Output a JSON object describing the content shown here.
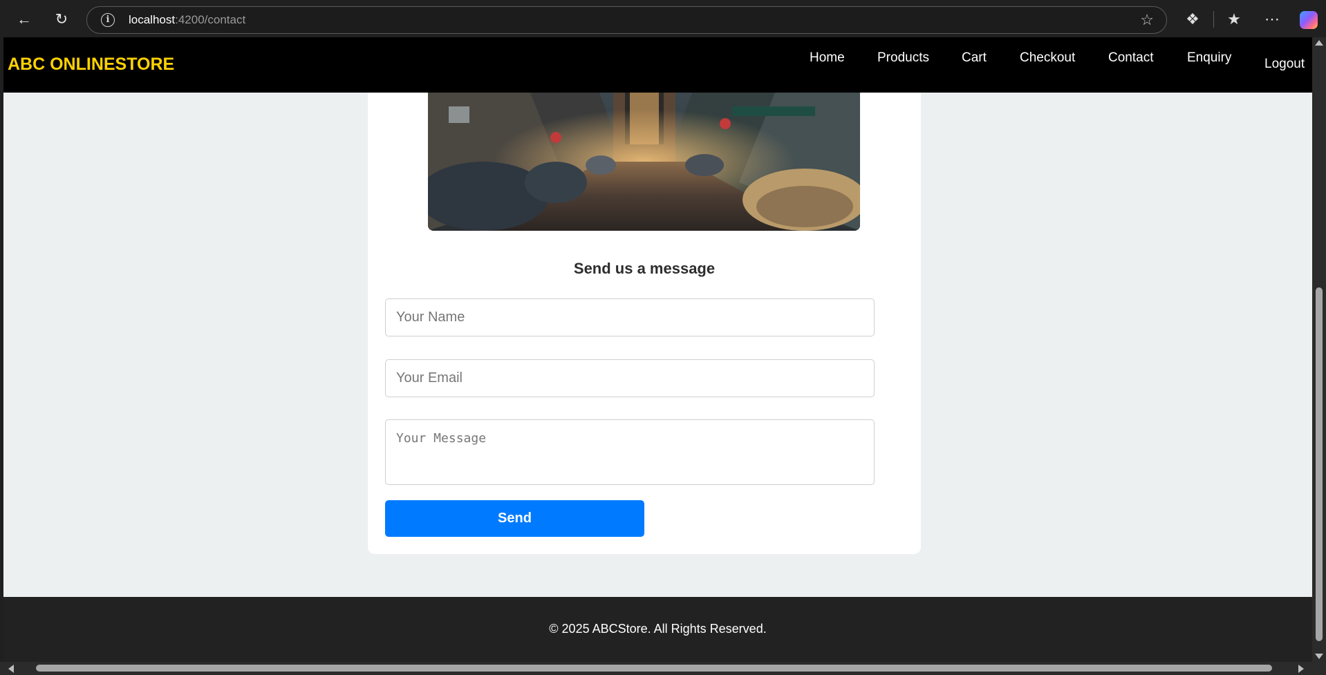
{
  "browser": {
    "url_host": "localhost",
    "url_path": ":4200/contact",
    "icons": [
      "back-arrow-icon",
      "refresh-icon",
      "site-info-icon",
      "favorite-star-icon",
      "extensions-icon",
      "favorites-icon",
      "more-icon",
      "copilot-icon"
    ]
  },
  "header": {
    "brand": "ABC ONLINESTORE",
    "nav": {
      "home": "Home",
      "products": "Products",
      "cart": "Cart",
      "checkout": "Checkout",
      "contact": "Contact",
      "enquiry": "Enquiry",
      "logout": "Logout"
    }
  },
  "contact": {
    "title": "Send us a message",
    "name_placeholder": "Your Name",
    "email_placeholder": "Your Email",
    "message_placeholder": "Your Message",
    "send_label": "Send"
  },
  "footer": {
    "text": "© 2025 ABCStore. All Rights Reserved."
  },
  "colors": {
    "brand": "#ffd200",
    "header_bg": "#000000",
    "page_bg": "#ecf0f1",
    "button": "#007bff",
    "footer_bg": "#222222"
  }
}
